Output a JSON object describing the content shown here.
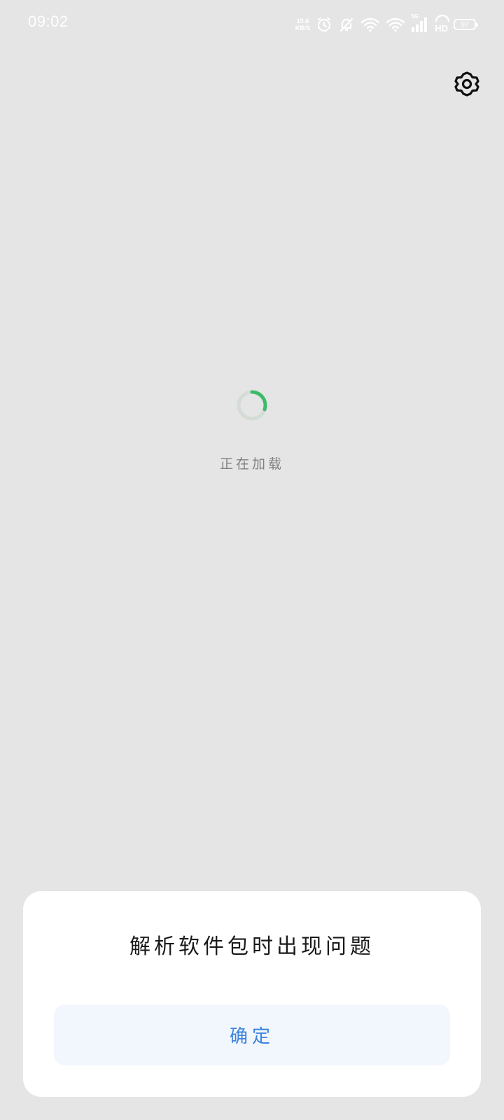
{
  "status_bar": {
    "time": "09:02",
    "net_speed_value": "15.6",
    "net_speed_unit": "KB/S",
    "signal_badge": "5G",
    "hd_badge": "HD",
    "battery_level": "97",
    "icons": [
      "alarm-icon",
      "notifications-off-icon",
      "wifi-icon",
      "wifi-icon",
      "cellular-signal-icon",
      "hd-call-icon",
      "battery-icon"
    ]
  },
  "toolbar": {
    "settings_icon": "gear-icon"
  },
  "loader": {
    "text": "正在加载",
    "progress": 0.3,
    "track_color": "#d4dcd6",
    "accent_color": "#3dba6a"
  },
  "dialog": {
    "title": "解析软件包时出现问题",
    "confirm_label": "确定",
    "accent_color": "#3a84dd"
  }
}
